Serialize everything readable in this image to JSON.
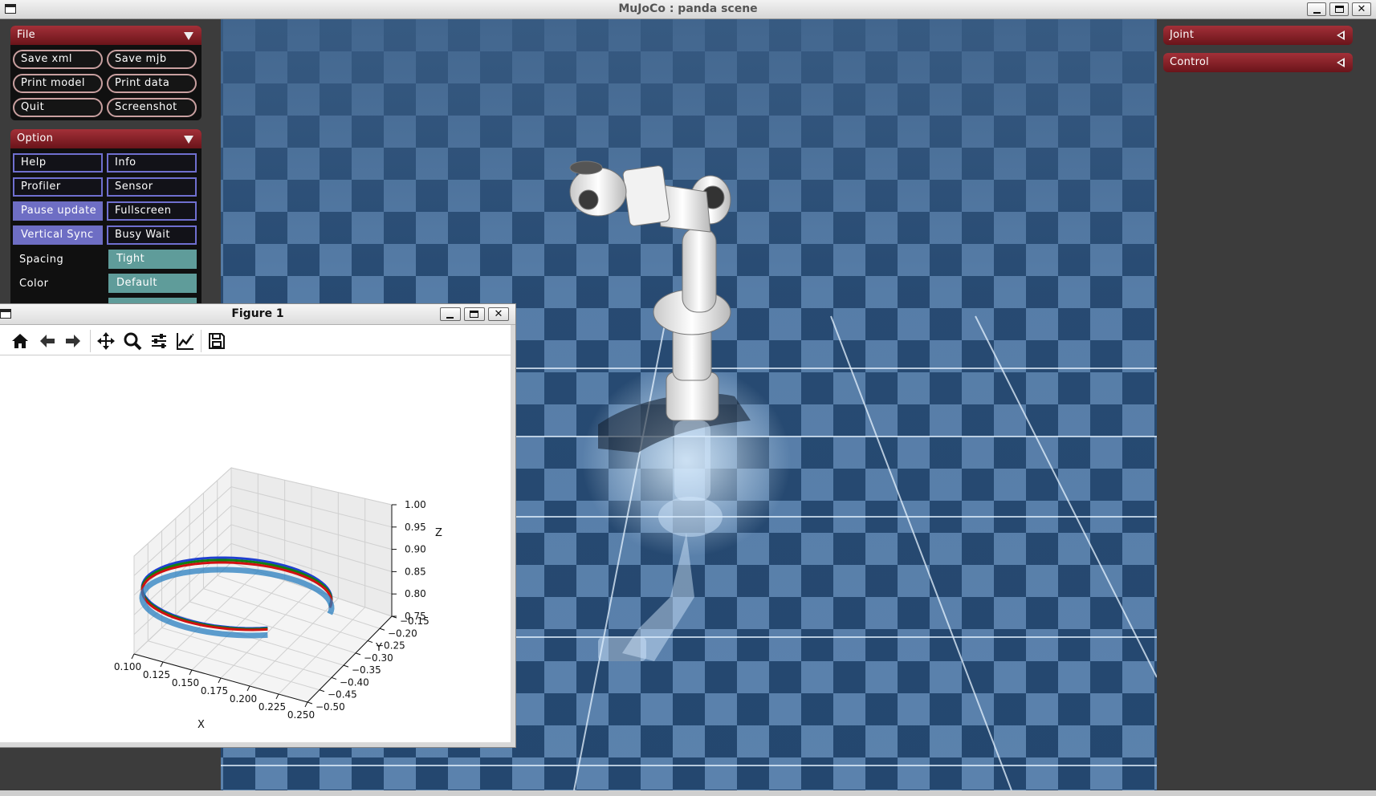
{
  "window": {
    "title": "MuJoCo : panda scene"
  },
  "file_section": {
    "title": "File",
    "buttons": [
      "Save xml",
      "Save mjb",
      "Print model",
      "Print data",
      "Quit",
      "Screenshot"
    ]
  },
  "option_section": {
    "title": "Option",
    "toggles": [
      "Help",
      "Info",
      "Profiler",
      "Sensor",
      "Pause update",
      "Fullscreen",
      "Vertical Sync",
      "Busy Wait"
    ],
    "active": [
      "Pause update",
      "Vertical Sync"
    ],
    "spacing_label": "Spacing",
    "spacing_value": "Tight",
    "color_label": "Color",
    "color_value": "Default"
  },
  "right_sections": {
    "joint": "Joint",
    "control": "Control"
  },
  "figure": {
    "title": "Figure 1",
    "toolbar_icons": [
      "home-icon",
      "back-arrow-icon",
      "forward-arrow-icon",
      "pan-icon",
      "zoom-icon",
      "configure-subplots-icon",
      "edit-axis-icon",
      "save-icon"
    ]
  },
  "chart_data": {
    "type": "line3d",
    "title": "",
    "xlabel": "X",
    "ylabel": "Y",
    "zlabel": "Z",
    "xticks": [
      "0.100",
      "0.125",
      "0.150",
      "0.175",
      "0.200",
      "0.225",
      "0.250"
    ],
    "yticks": [
      "−0.15",
      "−0.20",
      "−0.25",
      "−0.30",
      "−0.35",
      "−0.40",
      "−0.45",
      "−0.50"
    ],
    "zticks": [
      "0.75",
      "0.80",
      "0.85",
      "0.90",
      "0.95",
      "1.00"
    ],
    "xlim": [
      0.1,
      0.25
    ],
    "ylim": [
      -0.5,
      -0.15
    ],
    "zlim": [
      0.75,
      1.0
    ],
    "grid": true,
    "series_colors": [
      "#1f3fd0",
      "#108010",
      "#d01010",
      "#2a7fc0"
    ]
  },
  "colors": {
    "accent": "#a33038",
    "toggle_on": "#6e6ec4",
    "teal": "#5f9c9a",
    "floor_light": "#5f86b0",
    "floor_dark": "#1f4670"
  }
}
